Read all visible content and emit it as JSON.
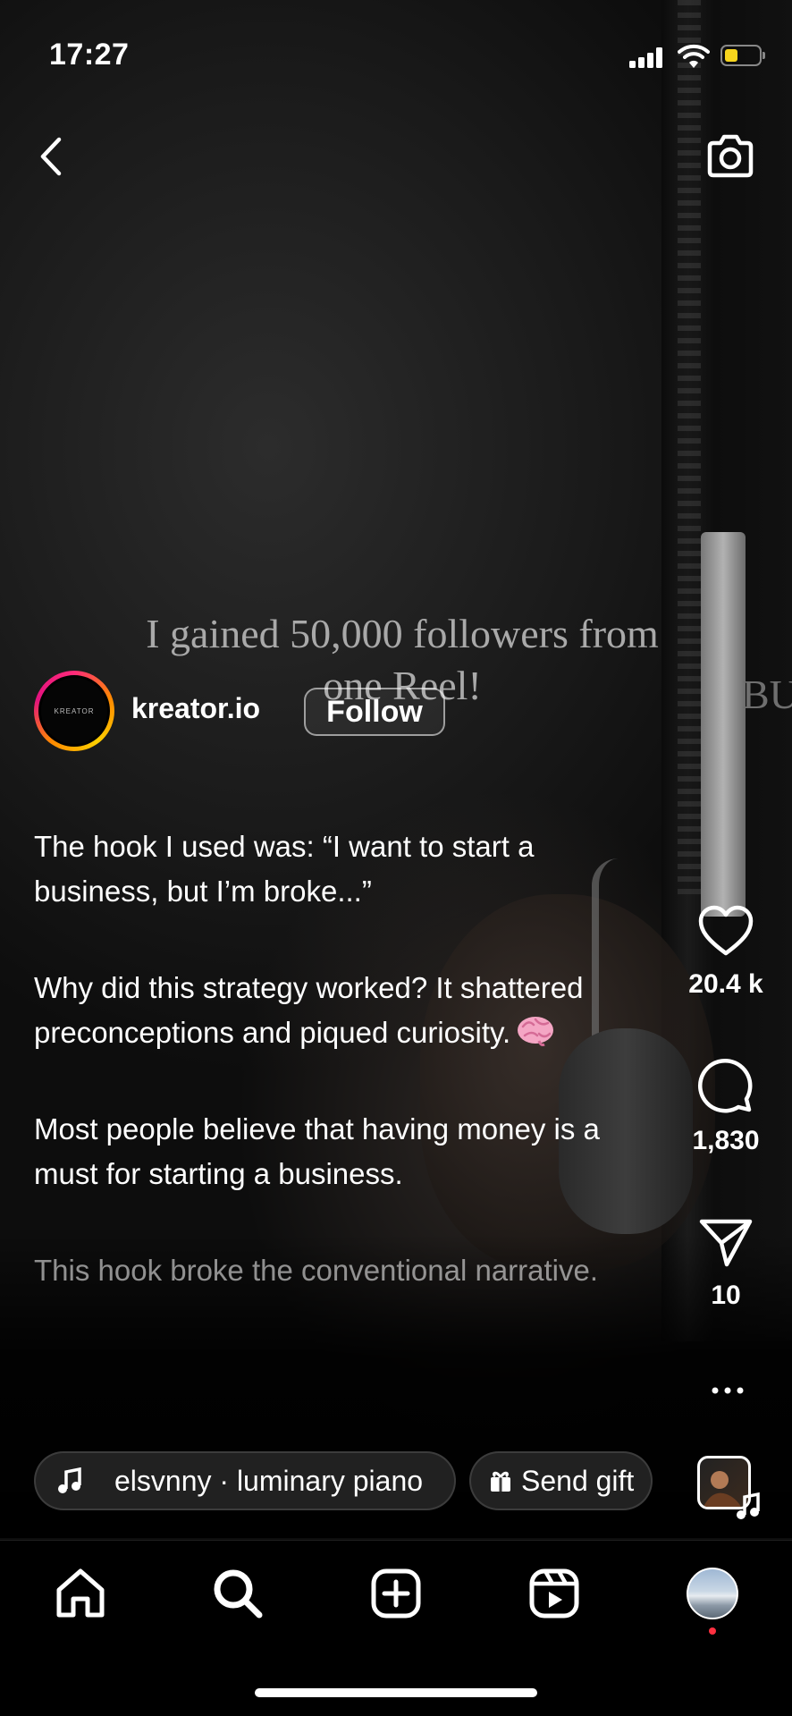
{
  "status_bar": {
    "time": "17:27",
    "battery_color": "#f7d51d"
  },
  "video": {
    "overlay_text": "I gained 50,000 followers from\none Reel!",
    "overlay_side": "BU"
  },
  "header": {
    "back_icon": "chevron-left-icon",
    "camera_icon": "camera-icon"
  },
  "author": {
    "avatar_text": "KREATOR",
    "username": "kreator.io",
    "follow_label": "Follow"
  },
  "caption": {
    "paragraphs": [
      "The hook I used was: “I want to start a business, but I’m broke...”",
      "Why did this strategy worked? It shattered preconceptions and piqued curiosity.",
      "Most people believe that having money is a must for starting a business.",
      "This hook broke the conventional narrative."
    ],
    "emoji": "brain-emoji"
  },
  "actions": {
    "likes": "20.4 k",
    "comments": "1,830",
    "shares": "10"
  },
  "audio": {
    "track": "elsvnny · luminary piano",
    "gift_label": "Send gift"
  },
  "nav": {
    "items": [
      "home-icon",
      "search-icon",
      "create-icon",
      "reels-icon",
      "profile-avatar"
    ],
    "notification_color": "#ff3040"
  }
}
